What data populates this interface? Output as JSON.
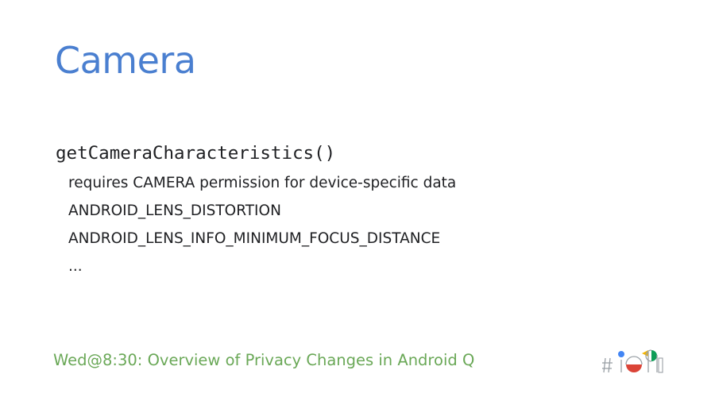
{
  "slide": {
    "title": "Camera",
    "code": "getCameraCharacteristics()",
    "bullets": [
      "requires CAMERA permission for device-specific data",
      "ANDROID_LENS_DISTORTION",
      "ANDROID_LENS_INFO_MINIMUM_FOCUS_DISTANCE",
      "..."
    ],
    "footer": "Wed@8:30: Overview of Privacy Changes in Android Q",
    "logo_text": "#io19"
  },
  "colors": {
    "title": "#4a7fd0",
    "footer": "#6aa857",
    "logo_blue": "#4285f4",
    "logo_red": "#db4437",
    "logo_yellow": "#f4b400",
    "logo_green": "#0f9d58"
  },
  "icons": {
    "event_logo": "google-io-19-logo"
  }
}
